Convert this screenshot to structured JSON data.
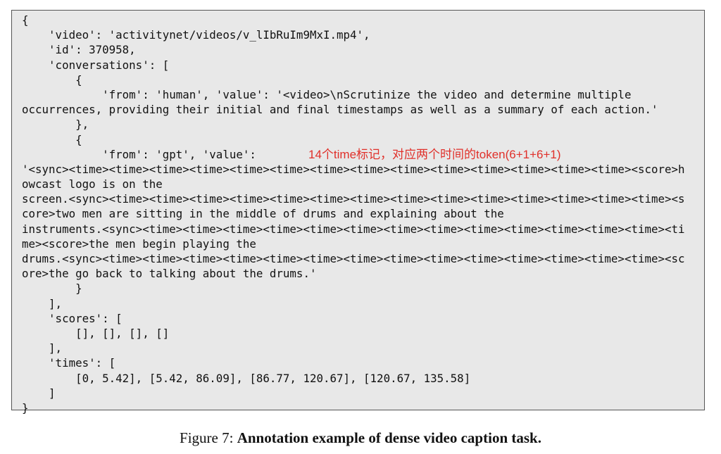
{
  "code_lines": [
    "{",
    "    'video': 'activitynet/videos/v_lIbRuIm9MxI.mp4',",
    "    'id': 370958,",
    "    'conversations': [",
    "        {",
    "            'from': 'human', 'value': '<video>\\nScrutinize the video and determine multiple",
    "occurrences, providing their initial and final timestamps as well as a summary of each action.'",
    "        },",
    "        {",
    "            'from': 'gpt', 'value':",
    "'<sync><time><time><time><time><time><time><time><time><time><time><time><time><time><time><score>h",
    "owcast logo is on the",
    "screen.<sync><time><time><time><time><time><time><time><time><time><time><time><time><time><time><s",
    "core>two men are sitting in the middle of drums and explaining about the",
    "instruments.<sync><time><time><time><time><time><time><time><time><time><time><time><time><time><ti",
    "me><score>the men begin playing the",
    "drums.<sync><time><time><time><time><time><time><time><time><time><time><time><time><time><time><sc",
    "ore>the go back to talking about the drums.'",
    "        }",
    "    ],",
    "    'scores': [",
    "        [], [], [], []",
    "    ],",
    "    'times': [",
    "        [0, 5.42], [5.42, 86.09], [86.77, 120.67], [120.67, 135.58]",
    "    ]",
    "}"
  ],
  "annotation": "14个time标记，对应两个时间的token(6+1+6+1)",
  "caption": {
    "label": "Figure 7:",
    "text": "Annotation example of dense video caption task."
  },
  "colors": {
    "annotation": "#e0302a",
    "code_background": "#e8e8e8",
    "border": "#555555"
  }
}
